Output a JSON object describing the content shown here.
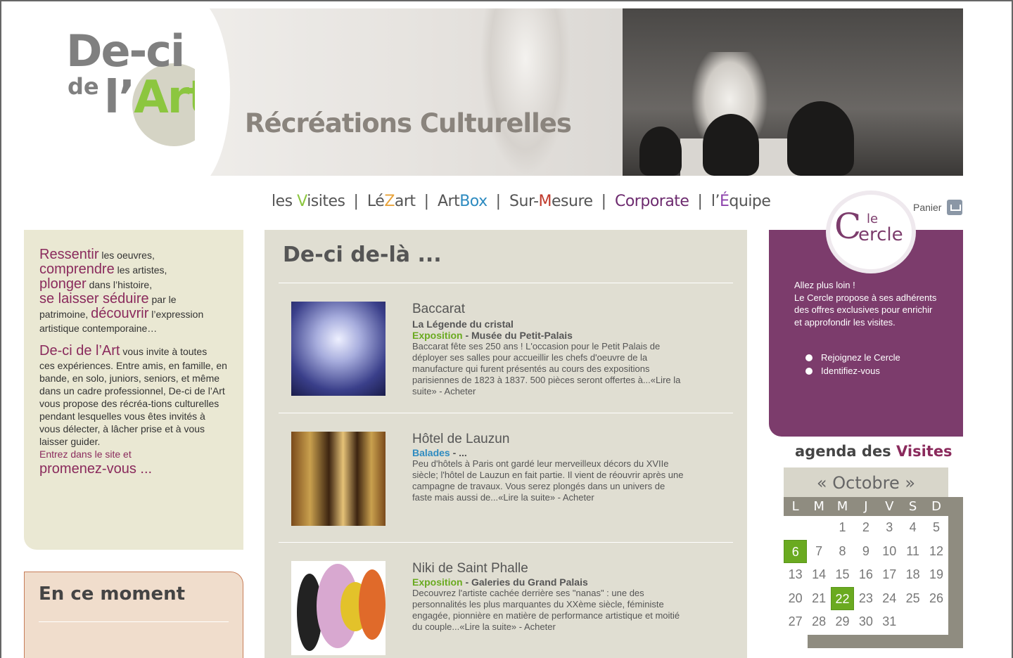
{
  "logo": {
    "line1": "De-ci",
    "line2": "de",
    "line3a": "l’",
    "line3b": "Art"
  },
  "banner": {
    "tagline": "Récréations Culturelles"
  },
  "nav": [
    {
      "pre": "les ",
      "mid": "V",
      "post": "isites",
      "color": "green"
    },
    {
      "pre": "Lé",
      "mid": "Z",
      "post": "art",
      "color": "orange"
    },
    {
      "pre": "Art",
      "mid": "Box",
      "post": "",
      "color": "blue"
    },
    {
      "pre": "Sur-",
      "mid": "M",
      "post": "esure",
      "color": "red"
    },
    {
      "pre": "",
      "mid": "Corporate",
      "post": "",
      "color": "purple"
    },
    {
      "pre": "l’",
      "mid": "É",
      "post": "quipe",
      "color": "violet"
    }
  ],
  "panier": {
    "label": "Panier",
    "icon": "cart-icon"
  },
  "intro": {
    "ressentir": "Ressentir",
    "ressentir_rest": " les oeuvres,",
    "comprendre": "comprendre",
    "comprendre_rest": " les artistes,",
    "plonger": "plonger",
    "plonger_rest": " dans l’histoire,",
    "seduire": "se laisser séduire",
    "seduire_rest": " par le",
    "patrimoine": "patrimoine, ",
    "decouvrir": "découvrir",
    "decouvrir_rest": " l’expression",
    "contemporaine": "artistique contemporaine…",
    "brand": "De-ci de l’Art",
    "brand_rest": " vous invite à  toutes",
    "body": "ces expériences. Entre amis, en famille, en bande, en solo, juniors, seniors, et même dans un cadre professionnel, De-ci de l’Art vous propose des récréa-tions culturelles pendant lesquelles vous êtes invités à vous  délecter, à lâcher prise et à vous laisser guider.",
    "entrez": "Entrez dans le site et",
    "promenez": "promenez-vous ..."
  },
  "moment": {
    "title": "En ce moment"
  },
  "center": {
    "title": "De-ci de-là ...",
    "articles": [
      {
        "title": "Baccarat",
        "subtitle": "La Légende du cristal",
        "category": "Exposition",
        "venue": " - Musée du Petit-Palais",
        "desc": "Baccarat fête ses 250 ans ! L'occasion pour le Petit Palais de déployer ses salles pour accueillir les chefs d'oeuvre de la manufacture qui furent présentés au cours des expositions parisiennes de 1823 à 1837. 500 pièces seront offertes à...«Lire la suite»   -   Acheter"
      },
      {
        "title": "Hôtel de Lauzun",
        "subtitle": "",
        "category": "Balades",
        "venue": " - ...",
        "desc": "Peu d'hôtels à Paris ont gardé leur merveilleux décors du XVIIe siècle; l'hôtel de Lauzun en fait partie. Il vient de réouvrir après une campagne de travaux. Vous serez plongés dans un univers de faste mais aussi de...«Lire la suite»   -   Acheter"
      },
      {
        "title": "Niki de Saint Phalle",
        "subtitle": "",
        "category": "Exposition",
        "venue": " - Galeries du Grand Palais",
        "desc": "Decouvrez l'artiste cachée derrière ses \"nanas\" :  une des personnalités les plus marquantes du XXème siècle, féministe engagée, pionnière en matière de performance artistique et moitié du couple...«Lire la suite»   -   Acheter"
      }
    ]
  },
  "cercle": {
    "badge_le": "le",
    "badge_C": "C",
    "badge_ercle": "ercle",
    "text1": "Allez plus loin !",
    "text2": "Le Cercle propose à ses adhérents des offres exclusives pour enrichir et approfondir les visites.",
    "links": [
      "Rejoignez le Cercle",
      "Identifiez-vous"
    ]
  },
  "agenda": {
    "title_pre": "agenda des ",
    "title_v": "Visites",
    "month": "« Octobre »",
    "days": [
      "L",
      "M",
      "M",
      "J",
      "V",
      "S",
      "D"
    ],
    "weeks": [
      [
        "",
        "",
        "1",
        "2",
        "3",
        "4",
        "5"
      ],
      [
        "6",
        "7",
        "8",
        "9",
        "10",
        "11",
        "12"
      ],
      [
        "13",
        "14",
        "15",
        "16",
        "17",
        "18",
        "19"
      ],
      [
        "20",
        "21",
        "22",
        "23",
        "24",
        "25",
        "26"
      ],
      [
        "27",
        "28",
        "29",
        "30",
        "31",
        "",
        ""
      ]
    ],
    "selected": [
      "6",
      "22"
    ]
  },
  "colors": {
    "green": "#8cc63f",
    "purple": "#7c3c6c",
    "plum": "#8a2a5c",
    "beige": "#eae8d3",
    "panel": "#e0ded2",
    "cal_grey": "#8f8c80"
  }
}
